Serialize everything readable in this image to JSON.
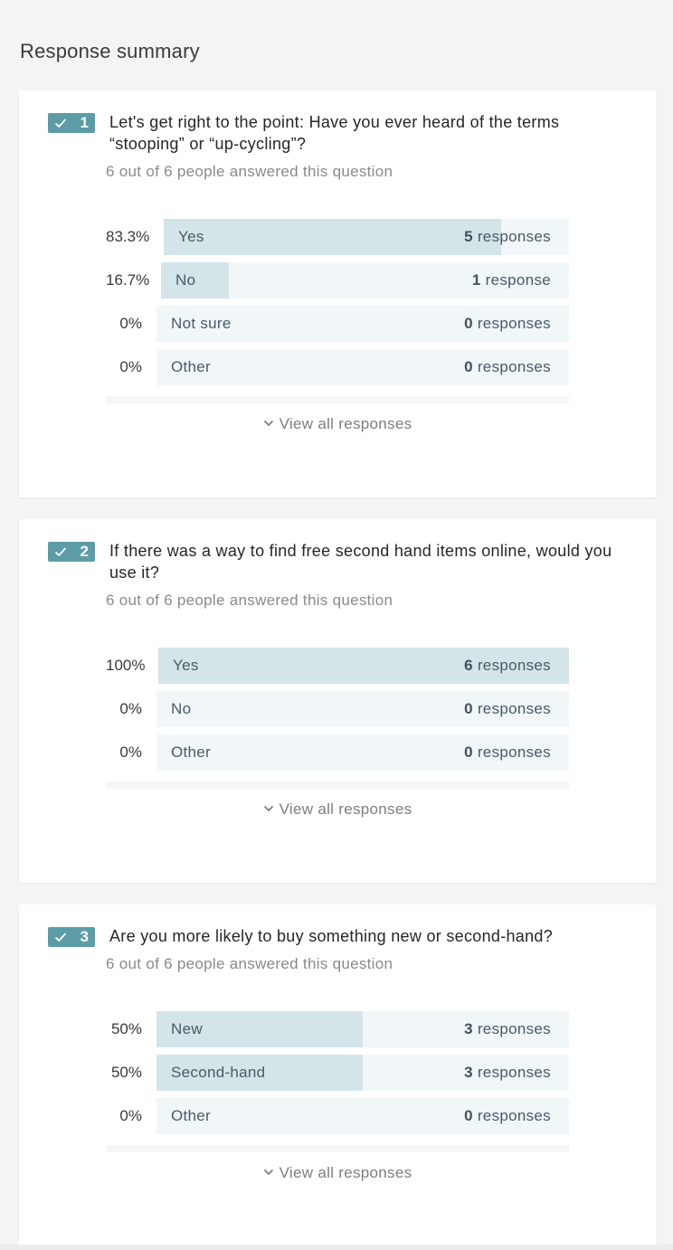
{
  "page_title": "Response summary",
  "view_all_label": "View all responses",
  "colors": {
    "accent": "#5c9ca7",
    "bar_fill": "#d4e5e9",
    "bar_bg": "#f1f7f8"
  },
  "questions": [
    {
      "number": "1",
      "title": "Let's get right to the point: Have you ever heard of the terms “stooping” or “up-cycling”?",
      "answered": "6 out of 6 people answered this question",
      "options": [
        {
          "pct": "83.3%",
          "label": "Yes",
          "count": "5",
          "unit": " responses",
          "fraction": 0.833
        },
        {
          "pct": "16.7%",
          "label": "No",
          "count": "1",
          "unit": " response",
          "fraction": 0.167
        },
        {
          "pct": "0%",
          "label": "Not sure",
          "count": "0",
          "unit": " responses",
          "fraction": 0
        },
        {
          "pct": "0%",
          "label": "Other",
          "count": "0",
          "unit": " responses",
          "fraction": 0
        }
      ]
    },
    {
      "number": "2",
      "title": "If there was a way to find free second hand items online, would you use it?",
      "answered": "6 out of 6 people answered this question",
      "options": [
        {
          "pct": "100%",
          "label": "Yes",
          "count": "6",
          "unit": " responses",
          "fraction": 1
        },
        {
          "pct": "0%",
          "label": "No",
          "count": "0",
          "unit": " responses",
          "fraction": 0
        },
        {
          "pct": "0%",
          "label": "Other",
          "count": "0",
          "unit": " responses",
          "fraction": 0
        }
      ]
    },
    {
      "number": "3",
      "title": "Are you more likely to buy something new or second-hand?",
      "answered": "6 out of 6 people answered this question",
      "options": [
        {
          "pct": "50%",
          "label": "New",
          "count": "3",
          "unit": " responses",
          "fraction": 0.5
        },
        {
          "pct": "50%",
          "label": "Second-hand",
          "count": "3",
          "unit": " responses",
          "fraction": 0.5
        },
        {
          "pct": "0%",
          "label": "Other",
          "count": "0",
          "unit": " responses",
          "fraction": 0
        }
      ]
    }
  ]
}
